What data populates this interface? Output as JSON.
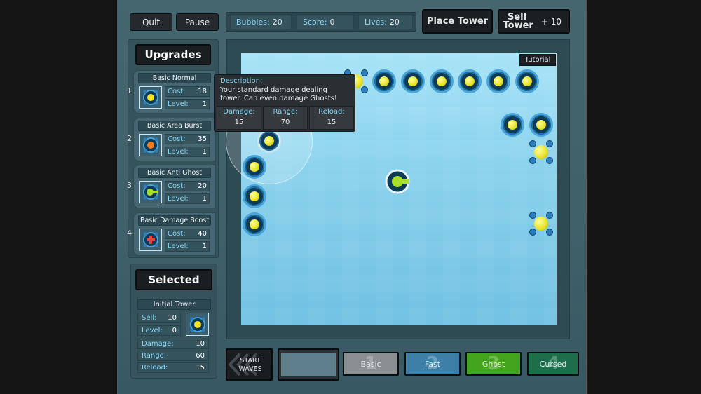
{
  "top": {
    "quit": "Quit",
    "pause": "Pause",
    "stats": [
      {
        "label": "Bubbles:",
        "value": "20"
      },
      {
        "label": "Score:",
        "value": "0"
      },
      {
        "label": "Lives:",
        "value": "20"
      }
    ],
    "place_tower": "Place Tower",
    "sell_tower": "Sell Tower",
    "plus_ten": "+ 10"
  },
  "upgrades": {
    "title": "Upgrades",
    "items": [
      {
        "num": "1",
        "name": "Basic Normal",
        "cost": "18",
        "level": "1",
        "color": "#f0e22a"
      },
      {
        "num": "2",
        "name": "Basic Area Burst",
        "cost": "35",
        "level": "1",
        "color": "#f07a1c"
      },
      {
        "num": "3",
        "name": "Basic Anti Ghost",
        "cost": "20",
        "level": "1",
        "color": "#a8e02a"
      },
      {
        "num": "4",
        "name": "Basic Damage Boost",
        "cost": "40",
        "level": "1",
        "color": "#e8443a"
      }
    ],
    "cost_label": "Cost:",
    "level_label": "Level:"
  },
  "selected": {
    "title": "Selected",
    "name": "Initial Tower",
    "sell_label": "Sell:",
    "sell": "10",
    "level_label": "Level:",
    "level": "0",
    "damage_label": "Damage:",
    "damage": "10",
    "range_label": "Range:",
    "range": "60",
    "reload_label": "Reload:",
    "reload": "15"
  },
  "tooltip": {
    "desc_label": "Description:",
    "desc": "Your standard damage dealing tower.  Can even damage Ghosts!",
    "damage_label": "Damage:",
    "damage": "15",
    "range_label": "Range:",
    "range": "70",
    "reload_label": "Reload:",
    "reload": "15"
  },
  "map": {
    "tutorial": "Tutorial"
  },
  "bottom": {
    "start_waves": "START WAVES",
    "waves": [
      {
        "num": "1",
        "label": "Basic",
        "color": "#8a8f93"
      },
      {
        "num": "2",
        "label": "Fast",
        "color": "#3d7fa6"
      },
      {
        "num": "3",
        "label": "Ghost",
        "color": "#43a51e"
      },
      {
        "num": "4",
        "label": "Cursed",
        "color": "#1c6f4a"
      }
    ]
  }
}
